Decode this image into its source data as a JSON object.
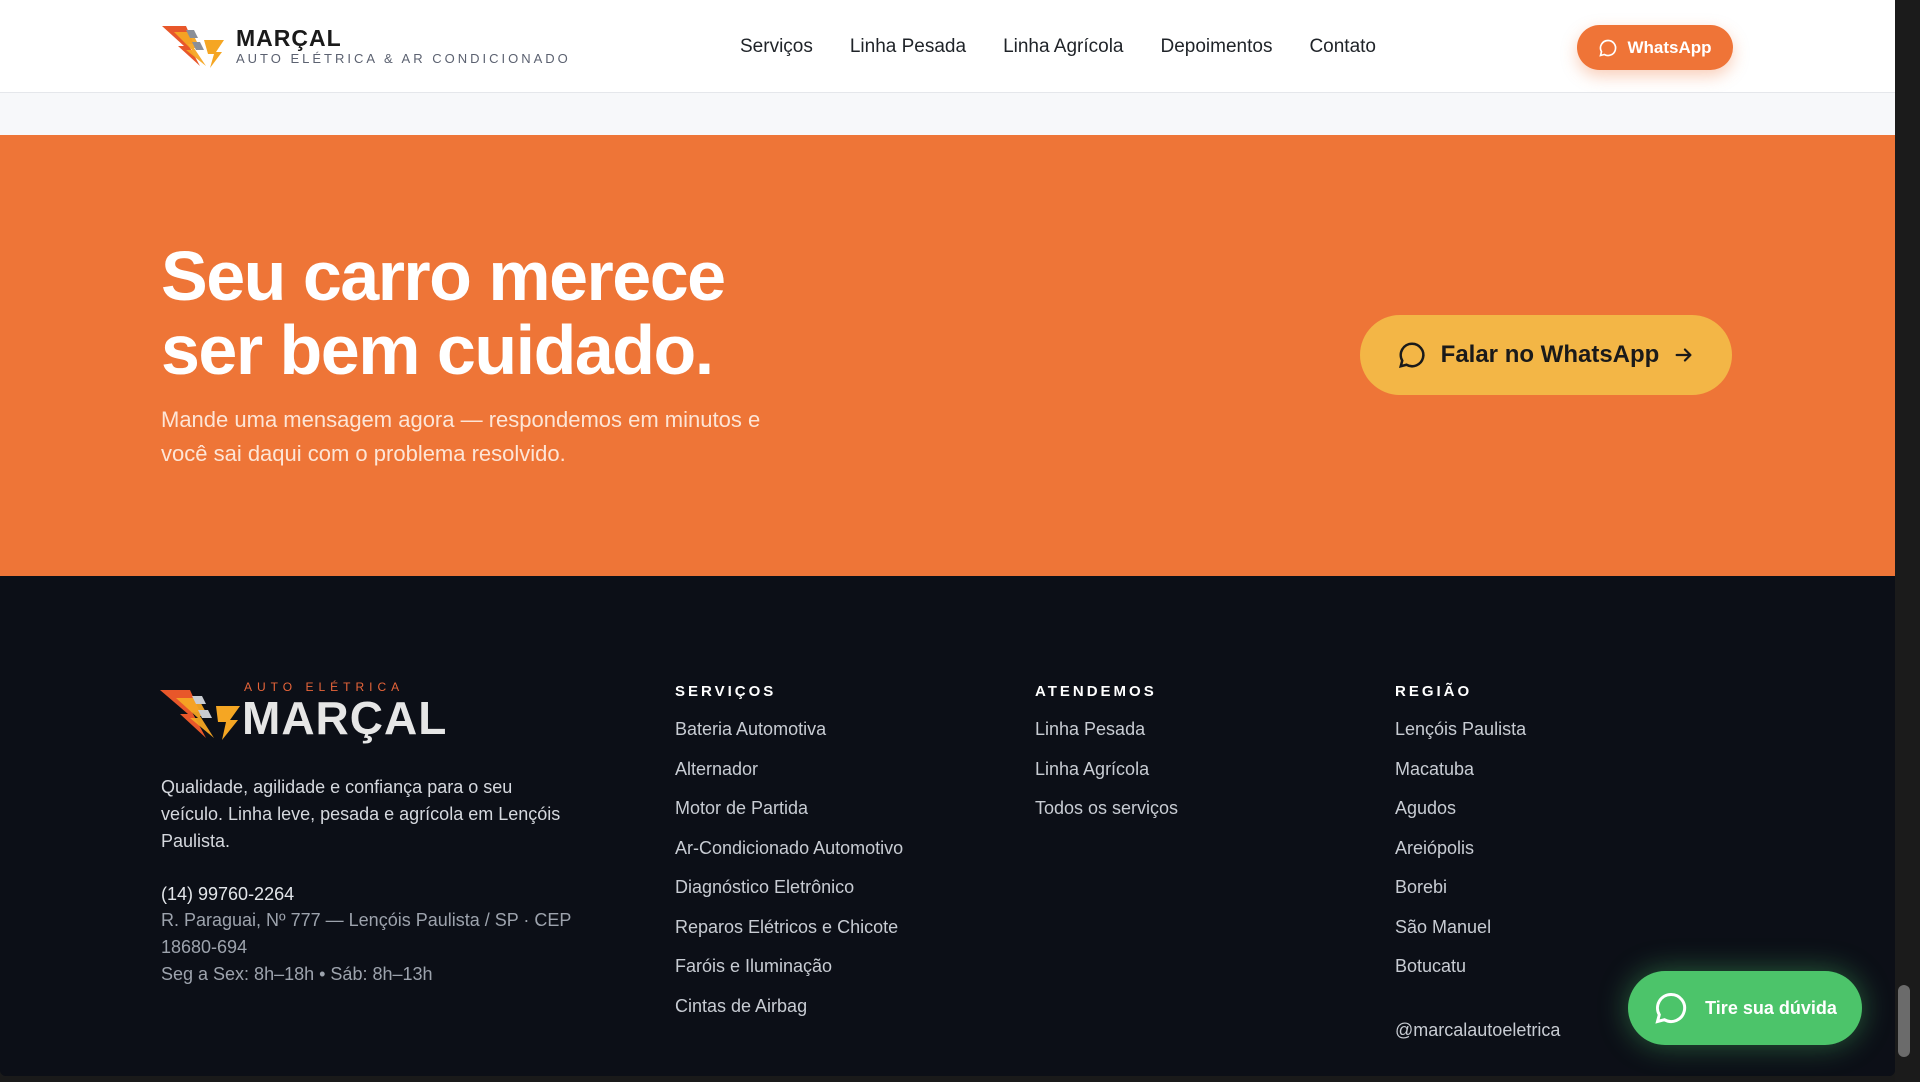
{
  "header": {
    "brand": "MARÇAL",
    "tagline": "AUTO ELÉTRICA & AR CONDICIONADO",
    "nav": [
      "Serviços",
      "Linha Pesada",
      "Linha Agrícola",
      "Depoimentos",
      "Contato"
    ],
    "whatsapp_label": "WhatsApp"
  },
  "cta": {
    "title_line1": "Seu carro merece",
    "title_line2": "ser bem cuidado.",
    "subtitle": "Mande uma mensagem agora — respondemos em minutos e você sai daqui com o problema resolvido.",
    "button_label": "Falar no WhatsApp"
  },
  "footer": {
    "logo_small": "AUTO ELÉTRICA",
    "logo_big": "MARÇAL",
    "description": "Qualidade, agilidade e confiança para o seu veículo. Linha leve, pesada e agrícola em Lençóis Paulista.",
    "phone": "(14) 99760-2264",
    "address": "R. Paraguai, Nº 777 — Lençóis Paulista / SP · CEP 18680-694",
    "hours": "Seg a Sex: 8h–18h • Sáb: 8h–13h",
    "columns": [
      {
        "title": "SERVIÇOS",
        "items": [
          "Bateria Automotiva",
          "Alternador",
          "Motor de Partida",
          "Ar-Condicionado Automotivo",
          "Diagnóstico Eletrônico",
          "Reparos Elétricos e Chicote",
          "Faróis e Iluminação",
          "Cintas de Airbag"
        ]
      },
      {
        "title": "ATENDEMOS",
        "items": [
          "Linha Pesada",
          "Linha Agrícola",
          "Todos os serviços"
        ]
      },
      {
        "title": "REGIÃO",
        "items": [
          "Lençóis Paulista",
          "Macatuba",
          "Agudos",
          "Areiópolis",
          "Borebi",
          "São Manuel",
          "Botucatu"
        ]
      }
    ],
    "instagram": "@marcalautoeletrica"
  },
  "chat_float": {
    "label": "Tire sua dúvida"
  },
  "colors": {
    "orange": "#ee7537",
    "yellow": "#f3b646",
    "footer_bg": "#0c0f17",
    "chat_green": "#4cc46a"
  },
  "icons": {
    "logo": "lightning-bolt-icon",
    "whatsapp": "chat-bubble-icon",
    "arrow": "arrow-right-icon"
  }
}
